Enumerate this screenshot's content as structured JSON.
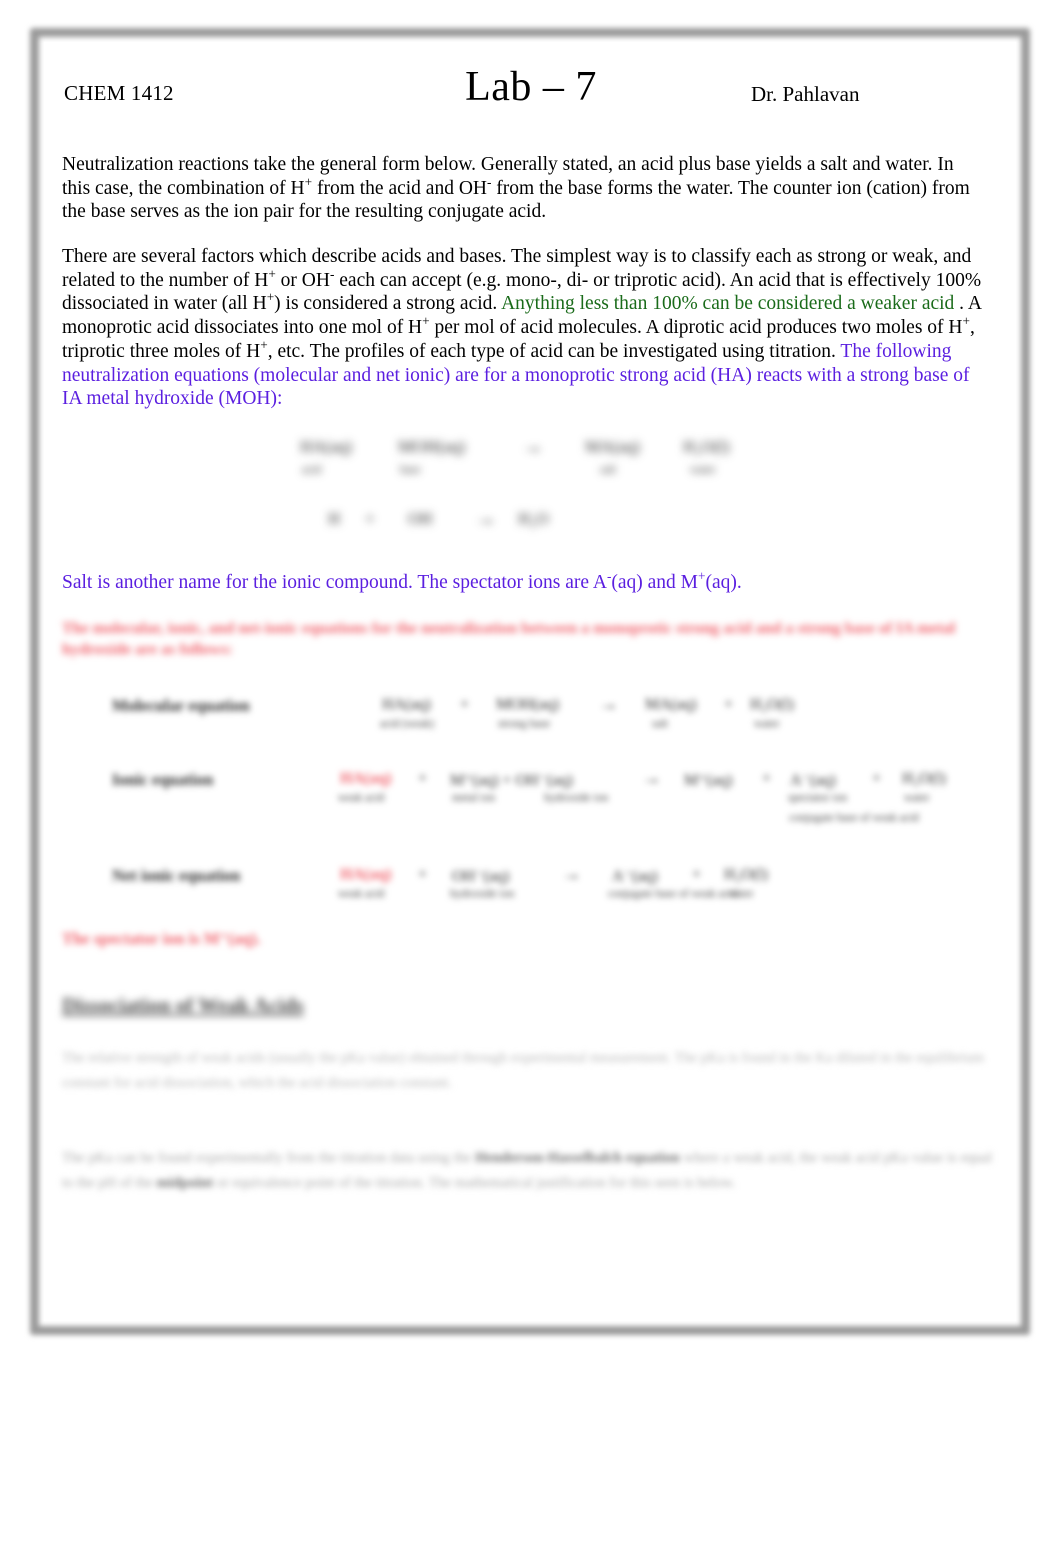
{
  "header": {
    "course": "CHEM 1412",
    "title": "Lab – 7",
    "instructor": "Dr. Pahlavan"
  },
  "paragraphs": {
    "p1_a": "Neutralization reactions",
    "p1_b": "  take the general form below. Generally stated, an acid plus base yields a salt and water. In this case, the combination of H",
    "p1_sup1": "+",
    "p1_c": " from the acid and OH",
    "p1_sup2": "-",
    "p1_d": " from the base forms the water. The counter ion (cation) from the base serves as the ion pair for the resulting conjugate acid.",
    "p2_a": " There are several factors which describe acids and bases. The simplest way is to classify each as strong or weak, and related to the number of H",
    "p2_sup1": "+",
    "p2_b": " or OH",
    "p2_sup2": "-",
    "p2_c": " each can accept (e.g. mono-, di- or triprotic acid). An acid that is effectively 100% dissociated in water (all H",
    "p2_sup3": "+",
    "p2_d": ") is considered a strong acid.  ",
    "p2_green": "Anything less than 100% can be considered a weaker acid",
    "p2_e": "  . A monoprotic  acid dissociates into one mol of H",
    "p2_sup4": "+",
    "p2_f": " per mol of acid molecules. A diprotic  acid produces two moles of H",
    "p2_sup5": "+",
    "p2_g": ", triprotic  three moles of H",
    "p2_sup6": "+",
    "p2_h": ", etc. The profiles of each type of acid can be investigated using titration. ",
    "p2_purple": "The following neutralization equations (molecular and net ionic) are for a monoprotic strong acid (HA) reacts with a strong base of IA metal hydroxide (MOH):"
  },
  "salt_line": {
    "a": "Salt is another name for the ionic compound. The spectator ions are A",
    "sup_minus": "-",
    "b": "(aq) and M",
    "sup_plus": "+",
    "c": "(aq)."
  },
  "equation_block": {
    "row1": {
      "t1": "HA(aq)",
      "t2": "MOH(aq)",
      "arrow": "→",
      "t3": "MA(aq)",
      "t4": "H₂O(l)",
      "c1": "acid",
      "c2": "base",
      "c3": "salt",
      "c4": "water"
    },
    "row2": {
      "t1": "H",
      "sup1": "+",
      "plus": "+",
      "t2": "OH",
      "sup2": "-",
      "arrow": "→",
      "t3": "H₂O"
    }
  },
  "red_note": "The molecular, ionic, and net-ionic equations for the neutralization between a monoprotic strong acid and a strong base of IA metal hydroxide are as follows:",
  "equations_table": {
    "rows": [
      {
        "label": "Molecular equation",
        "terms": [
          "HA(aq)",
          "+",
          "MOH(aq)",
          "→",
          "MA(aq)",
          "+",
          "H₂O(l)"
        ],
        "captions": [
          "acid (weak)",
          "",
          "strong base",
          "",
          "salt",
          "",
          "water"
        ]
      },
      {
        "label": "Ionic equation",
        "terms": [
          "HA(aq)",
          "+",
          "M⁺(aq) + OH⁻(aq)",
          "→",
          "M⁺(aq)",
          "+",
          "A⁻(aq)",
          "+",
          "H₂O(l)"
        ],
        "captions": [
          "weak acid",
          "",
          "metal ion",
          "hydroxide ion",
          "",
          "spectator ion",
          "conjugate base of weak acid",
          "",
          "water"
        ]
      },
      {
        "label": "Net ionic equation",
        "terms": [
          "HA(aq)",
          "+",
          "OH⁻(aq)",
          "→",
          "A⁻(aq)",
          "+",
          "H₂O(l)"
        ],
        "captions": [
          "weak acid",
          "",
          "hydroxide ion",
          "",
          "conjugate base of weak acid",
          "",
          "water"
        ]
      }
    ]
  },
  "red_spectator": "The spectator ion is M⁺(aq).",
  "section_heading": "Dissociation of Weak Acids",
  "body_p1": "The relative strength of weak acids (usually the pKa value) obtained through experimental measurement. The pKa is found in the Ka diluted in the equilibrium constant for acid dissociation, which the acid dissociation constant.",
  "body_p1_bold": "acid dissociation constant.",
  "body_p2_a": "The pKa can be found experimentally from the titration data using the ",
  "body_p2_bold1": "Henderson-Hasselbalch equation",
  "body_p2_b": " where a weak acid, the weak acid pKa value is equal to the pH of the ",
  "body_p2_bold2": "midpoint",
  "body_p2_c": " or equivalence point of the titration. The mathematical justification for this seen is below."
}
